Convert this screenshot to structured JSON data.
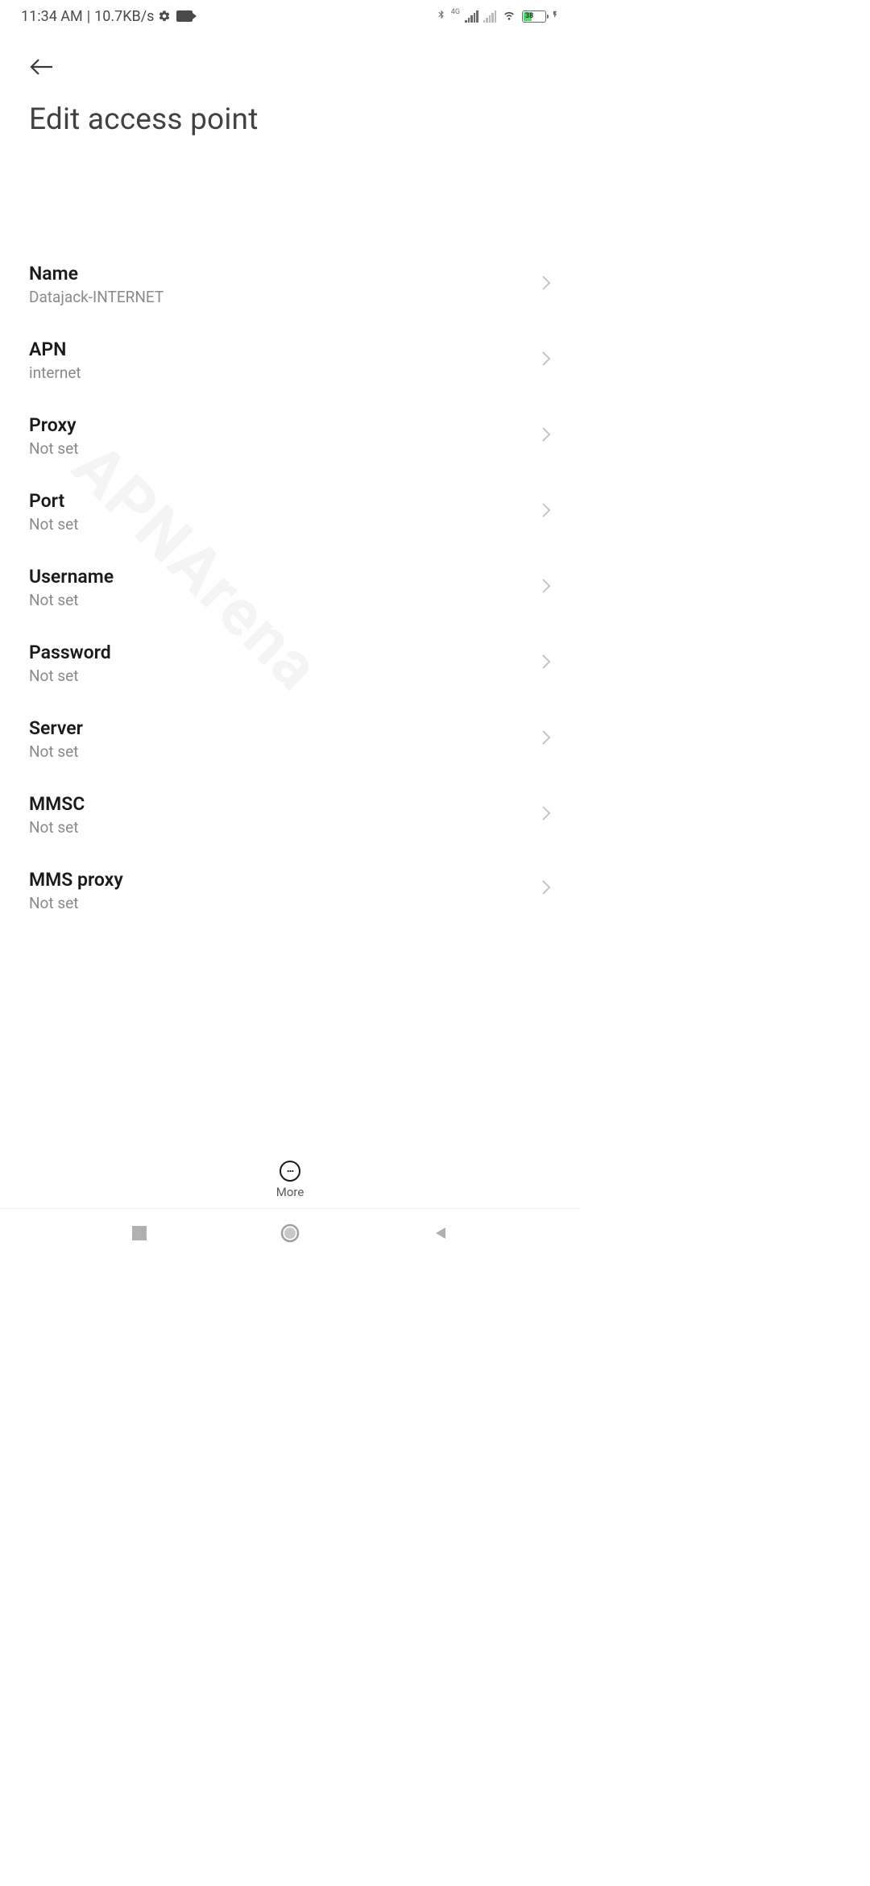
{
  "statusBar": {
    "time": "11:34 AM",
    "dataRate": "10.7KB/s",
    "networkType": "4G",
    "batteryPercent": "38"
  },
  "page": {
    "title": "Edit access point"
  },
  "settings": [
    {
      "label": "Name",
      "value": "Datajack-INTERNET"
    },
    {
      "label": "APN",
      "value": "internet"
    },
    {
      "label": "Proxy",
      "value": "Not set"
    },
    {
      "label": "Port",
      "value": "Not set"
    },
    {
      "label": "Username",
      "value": "Not set"
    },
    {
      "label": "Password",
      "value": "Not set"
    },
    {
      "label": "Server",
      "value": "Not set"
    },
    {
      "label": "MMSC",
      "value": "Not set"
    },
    {
      "label": "MMS proxy",
      "value": "Not set"
    }
  ],
  "bottomBar": {
    "more": "More"
  },
  "watermark": "APNArena"
}
